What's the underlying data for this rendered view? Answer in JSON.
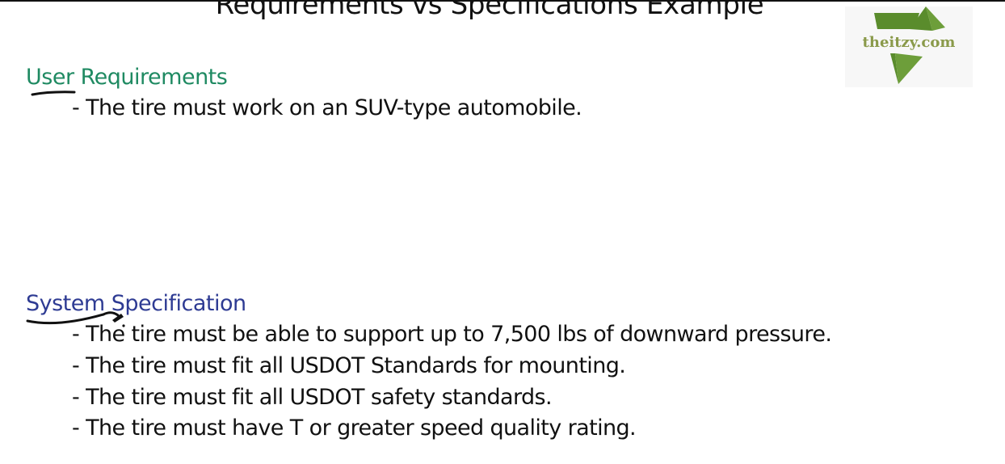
{
  "slide": {
    "title": "Requirements vs Specifications Example"
  },
  "logo": {
    "text": "theitzy.com",
    "icon": "green-flag-logo-icon"
  },
  "user_requirements": {
    "heading": "User Requirements",
    "bullets": [
      "- The tire must work on an SUV-type automobile."
    ]
  },
  "system_specification": {
    "heading": "System Specification",
    "bullets": [
      "- The tire must be able to support up to 7,500 lbs of downward pressure.",
      "- The tire must fit all USDOT Standards for mounting.",
      "- The tire must fit all USDOT safety standards.",
      "- The tire must have T or greater speed quality rating."
    ]
  },
  "colors": {
    "user_heading": "#1f8a62",
    "system_heading": "#2e3b93",
    "logo_green": "#5a8c2c",
    "logo_text": "#8a9a4a",
    "ink": "#111111"
  }
}
